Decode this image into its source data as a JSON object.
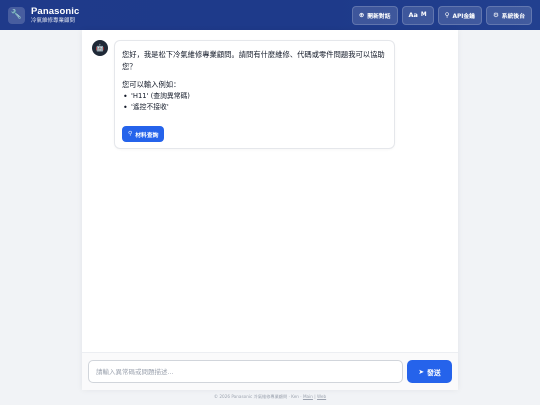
{
  "header": {
    "logo_icon": "wrench-icon",
    "title": "Panasonic",
    "subtitle": "冷氣維修專業顧問",
    "buttons": [
      {
        "icon": "⊕",
        "label": "開新對話"
      },
      {
        "icon": "Aa",
        "label": "M"
      },
      {
        "icon": "⚲",
        "label": "API金鑰"
      },
      {
        "icon": "⚙",
        "label": "系統後台"
      }
    ]
  },
  "chat": {
    "bot_avatar_icon": "robot-icon",
    "greeting": "您好，我是松下冷氣維修專業顧問。請問有什麼維修、代碼或零件問題我可以協助您？",
    "hint": "您可以輸入例如：",
    "examples": [
      "'H11' (查詢異常碼)",
      "'遙控不接收'"
    ],
    "parts_button": {
      "icon": "⚲",
      "label": "材料查詢"
    }
  },
  "input": {
    "placeholder": "請輸入異常碼或問題描述...",
    "send_label": "發送",
    "send_icon": "➤"
  },
  "footer": {
    "text": "© 2026 Panasonic 冷氣維修專業顧問 · Ken ·",
    "link1": "Main",
    "sep": " | ",
    "link2": "Web"
  }
}
